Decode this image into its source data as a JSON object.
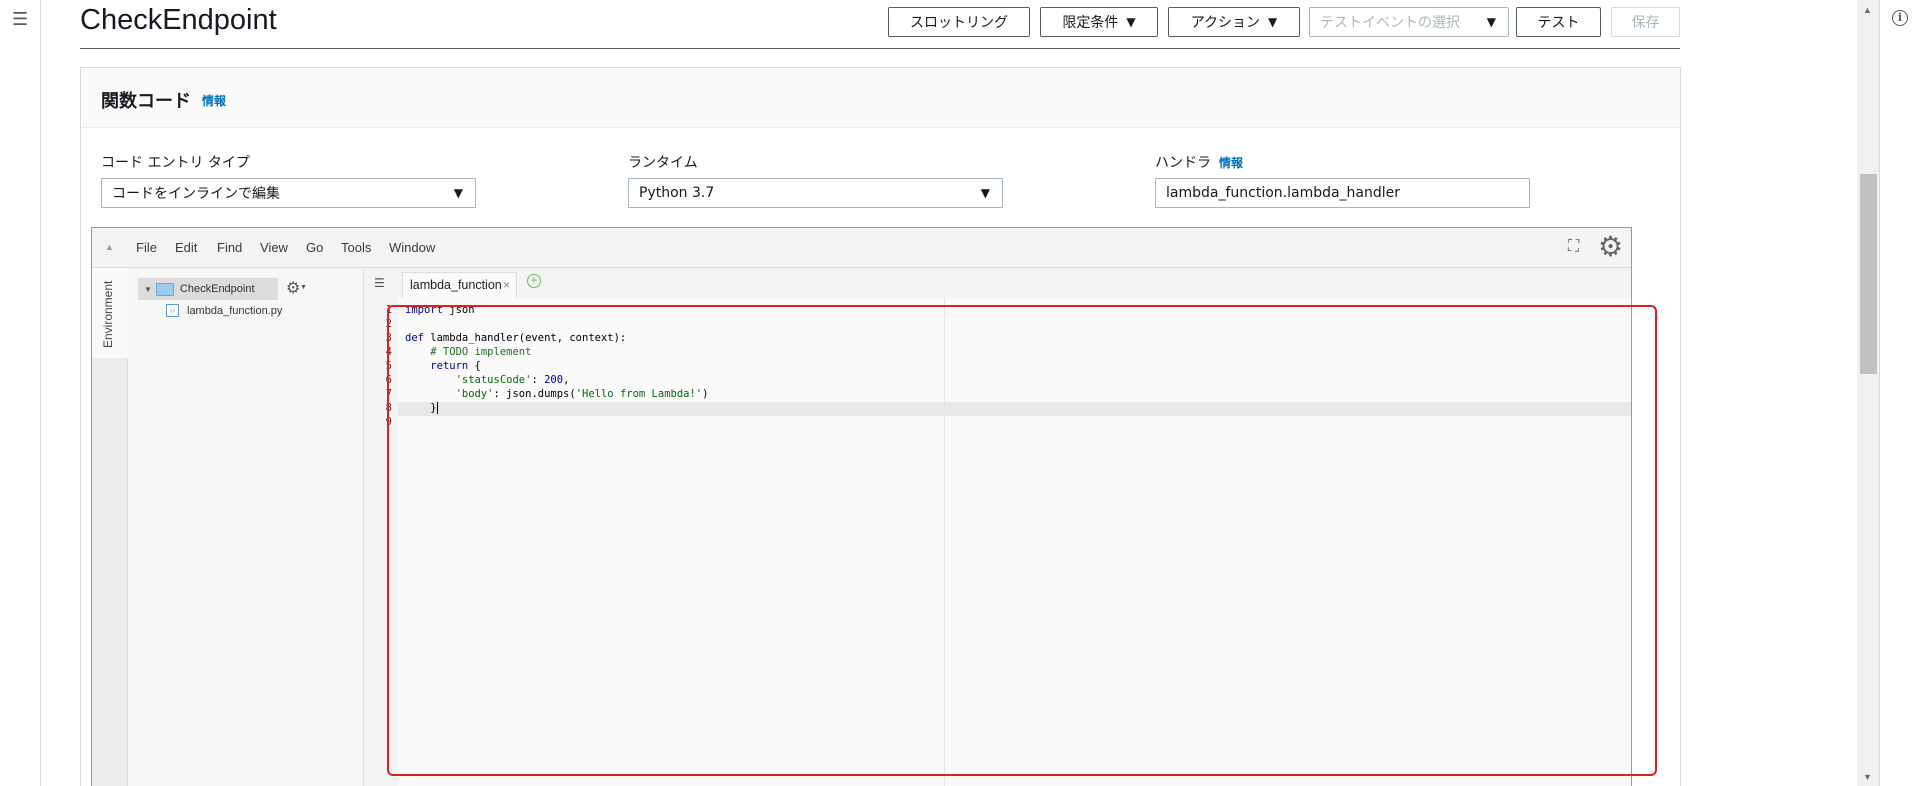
{
  "header": {
    "title": "CheckEndpoint",
    "throttle": "スロットリング",
    "qualifiers": "限定条件",
    "actions": "アクション",
    "test_event_placeholder": "テストイベントの選択",
    "test": "テスト",
    "save": "保存"
  },
  "section": {
    "title": "関数コード",
    "info": "情報"
  },
  "fields": {
    "entry_type_label": "コード エントリ タイプ",
    "entry_type_value": "コードをインラインで編集",
    "runtime_label": "ランタイム",
    "runtime_value": "Python 3.7",
    "handler_label": "ハンドラ",
    "handler_info": "情報",
    "handler_value": "lambda_function.lambda_handler"
  },
  "editor": {
    "menu": [
      "File",
      "Edit",
      "Find",
      "View",
      "Go",
      "Tools",
      "Window"
    ],
    "environment_tab": "Environment",
    "tree_root": "CheckEndpoint",
    "tree_file": "lambda_function.py",
    "open_tab": "lambda_function",
    "line_numbers": [
      "1",
      "2",
      "3",
      "4",
      "5",
      "6",
      "7",
      "8",
      "9"
    ],
    "code": {
      "l1_kw": "import",
      "l1_rest": " json",
      "l3_kw": "def",
      "l3_rest": " lambda_handler(event, context):",
      "l4": "    # TODO implement",
      "l5_kw": "return",
      "l5_rest": " {",
      "l6_key": "'statusCode'",
      "l6_sep": ": ",
      "l6_num": "200",
      "l6_end": ",",
      "l7_key": "'body'",
      "l7_mid": ": json.dumps(",
      "l7_str": "'Hello from Lambda!'",
      "l7_end": ")",
      "l8": "    }"
    }
  },
  "icons": {
    "menu": "hamburger-icon",
    "info": "info-icon",
    "fullscreen": "expand-icon",
    "settings": "gear-icon",
    "folder": "folder-icon",
    "file": "python-file-icon"
  },
  "colors": {
    "highlight": "#e0201f",
    "link": "#0073bb"
  }
}
